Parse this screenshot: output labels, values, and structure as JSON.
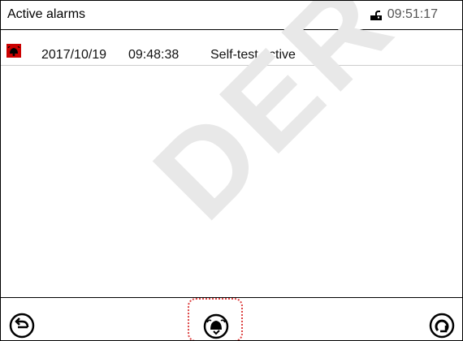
{
  "header": {
    "title": "Active alarms",
    "clock": "09:51:17"
  },
  "alarm_list": [
    {
      "date": "2017/10/19",
      "time": "09:48:38",
      "message": "Self-test active"
    }
  ],
  "colors": {
    "alarm": "#cc0000",
    "highlight": "#dd4444"
  },
  "icons": {
    "header": "lock-icon",
    "alarm": "alarm-bell-icon",
    "back": "back-arrow-icon",
    "acknowledge": "acknowledge-alarm-icon",
    "refresh": "refresh-icon"
  },
  "watermark": "DER SAS"
}
